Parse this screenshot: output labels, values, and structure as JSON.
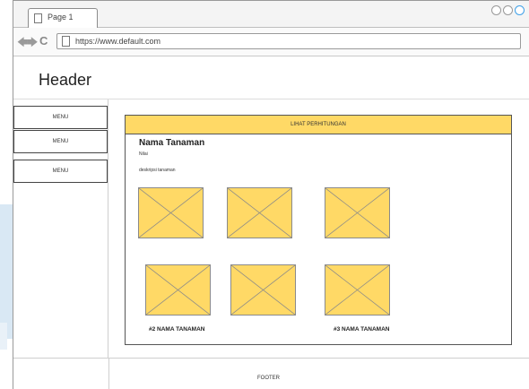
{
  "browser": {
    "tab_label": "Page 1",
    "url": "https://www.default.com"
  },
  "header": {
    "title": "Header"
  },
  "sidebar": {
    "items": [
      {
        "label": "MENU"
      },
      {
        "label": "MENU"
      },
      {
        "label": "MENU"
      }
    ]
  },
  "main": {
    "banner_label": "LIHAT PERHITUNGAN",
    "plant_name": "Nama Tanaman",
    "plant_value": "Nilai",
    "plant_description": "deskripsi tanaman",
    "captions": [
      "#2 NAMA TANAMAN",
      "#3 NAMA TANAMAN"
    ]
  },
  "footer": {
    "text": "FOOTER"
  },
  "colors": {
    "placeholder_fill": "#ffd966",
    "banner_fill": "#ffd966",
    "accent_blue": "#3fa0e8"
  }
}
